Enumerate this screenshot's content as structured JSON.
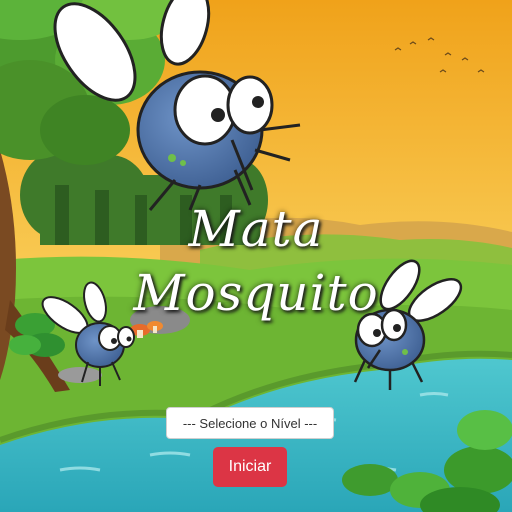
{
  "game": {
    "title_line1": "Mata",
    "title_line2": "Mosquito",
    "level_select": {
      "selected": "--- Selecione o Nível ---",
      "options": [
        "--- Selecione o Nível ---"
      ]
    },
    "start_label": "Iniciar"
  },
  "colors": {
    "sky_top": "#f2a91e",
    "sky_bottom": "#fde6a0",
    "grass": "#77c13a",
    "water": "#35b7c4",
    "start_button": "#dc3545",
    "mosquito_body": "#4a6fa5"
  },
  "icons": [
    "mosquito-icon",
    "tree-icon",
    "rock-icon",
    "leaf-icon",
    "mushroom-icon"
  ]
}
